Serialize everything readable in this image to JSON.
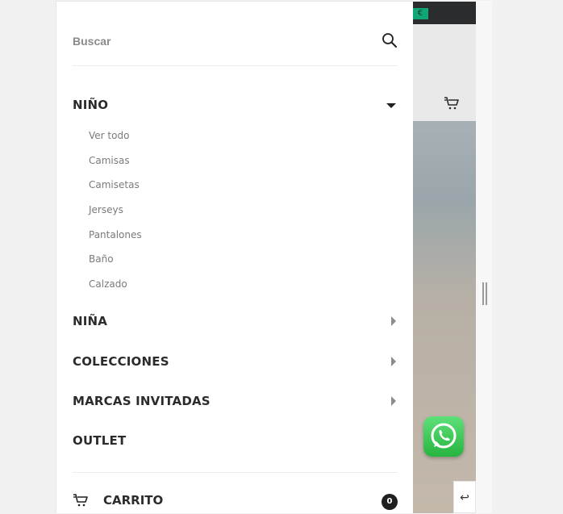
{
  "search": {
    "placeholder": "Buscar",
    "icon": "search-icon"
  },
  "background": {
    "currency_symbol": "€",
    "accent_color": "#11a676",
    "whatsapp_color": "#27b43f",
    "back_symbol": "↩"
  },
  "menu": {
    "items": [
      {
        "label": "NIÑO",
        "expanded": true,
        "subitems": [
          "Ver todo",
          "Camisas",
          "Camisetas",
          "Jerseys",
          "Pantalones",
          "Baño",
          "Calzado"
        ]
      },
      {
        "label": "NIÑA",
        "expanded": false
      },
      {
        "label": "COLECCIONES",
        "expanded": false
      },
      {
        "label": "MARCAS INVITADAS",
        "expanded": false
      },
      {
        "label": "OUTLET",
        "expanded": false
      }
    ]
  },
  "cart": {
    "label": "CARRITO",
    "count": "0"
  }
}
